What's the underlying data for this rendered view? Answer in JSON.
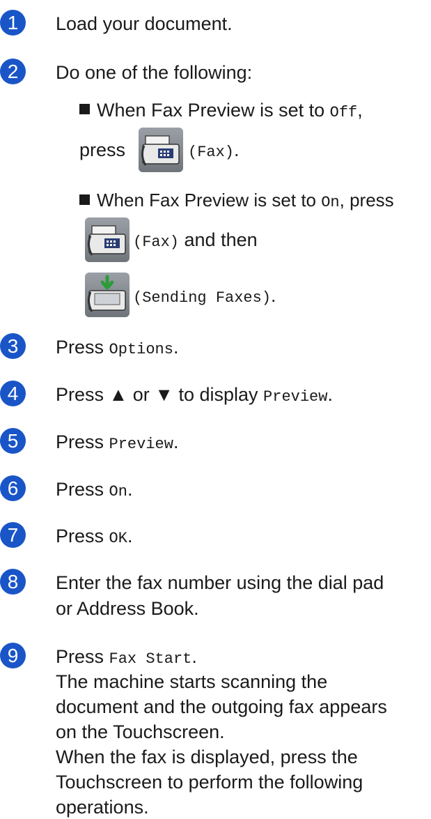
{
  "steps": {
    "s1": {
      "num": "1",
      "text": "Load your document."
    },
    "s2": {
      "num": "2",
      "text": "Do one of the following:"
    },
    "b1": {
      "pre": "When Fax Preview is set to ",
      "code": "Off",
      "post": ",",
      "press": "press",
      "code2": "(Fax)",
      "end": "."
    },
    "b2": {
      "pre": "When Fax Preview is set to ",
      "code": "On",
      "post": ", press",
      "code2": "(Fax)",
      "and_then": " and then",
      "code3": "(Sending Faxes)",
      "end": "."
    },
    "s3": {
      "num": "3",
      "pre": "Press ",
      "code": "Options",
      "end": "."
    },
    "s4": {
      "num": "4",
      "pre": "Press ▲ or ▼ to display ",
      "code": "Preview",
      "end": "."
    },
    "s5": {
      "num": "5",
      "pre": "Press ",
      "code": "Preview",
      "end": "."
    },
    "s6": {
      "num": "6",
      "pre": "Press ",
      "code": "On",
      "end": "."
    },
    "s7": {
      "num": "7",
      "pre": "Press ",
      "code": "OK",
      "end": "."
    },
    "s8": {
      "num": "8",
      "line1": "Enter the fax number using the dial pad",
      "line2": "or Address Book."
    },
    "s9": {
      "num": "9",
      "pre": "Press ",
      "code": "Fax Start",
      "end": ".",
      "lines": [
        "The machine starts scanning the",
        "document and the outgoing fax appears",
        "on the Touchscreen.",
        "When the fax is displayed, press the",
        "Touchscreen to perform the following",
        "operations."
      ]
    }
  },
  "icons": [
    "fax-icon",
    "fax-icon",
    "sending-faxes-icon"
  ],
  "colors": {
    "badge": "#1a55c8",
    "text": "#1a1a1a"
  }
}
